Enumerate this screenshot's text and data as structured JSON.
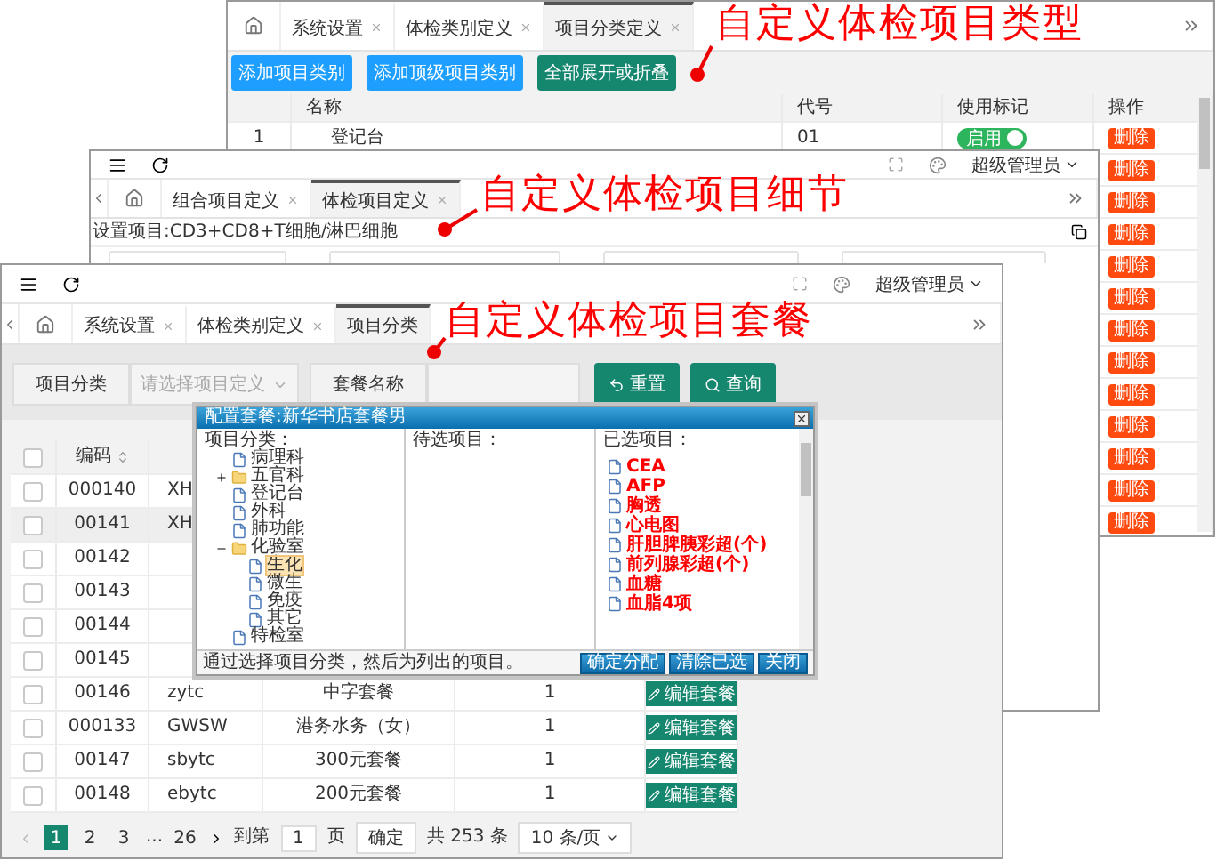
{
  "windows": [
    {
      "kind": "categories",
      "tabs": [
        {
          "label": "系统设置",
          "selected": false
        },
        {
          "label": "体检类别定义",
          "selected": false
        },
        {
          "label": "项目分类定义",
          "selected": true
        }
      ],
      "toolbar": [
        {
          "label": "添加项目类别",
          "color": "#1e9fff"
        },
        {
          "label": "添加顶级项目类别",
          "color": "#1e9fff"
        },
        {
          "label": "全部展开或折叠",
          "color": "#16876f"
        }
      ],
      "columns": [
        "名称",
        "代号",
        "使用标记",
        "操作"
      ],
      "rows": [
        {
          "index": "1",
          "name": "登记台",
          "code": "01",
          "flag": {
            "on": true,
            "label": "启用"
          },
          "action": "删除"
        },
        {
          "action": "删除"
        },
        {
          "action": "删除"
        },
        {
          "action": "删除"
        },
        {
          "action": "删除"
        },
        {
          "action": "删除"
        },
        {
          "action": "删除"
        },
        {
          "action": "删除"
        },
        {
          "action": "删除"
        },
        {
          "action": "删除"
        },
        {
          "action": "删除"
        },
        {
          "action": "删除"
        },
        {
          "action": "删除"
        }
      ]
    },
    {
      "kind": "details",
      "user": "超级管理员",
      "tabs": [
        {
          "label": "组合项目定义",
          "selected": false
        },
        {
          "label": "体检项目定义",
          "selected": true
        }
      ],
      "breadcrumb": "设置项目:CD3+CD8+T细胞/淋巴细胞"
    },
    {
      "kind": "packages",
      "user": "超级管理员",
      "tabs": [
        {
          "label": "系统设置",
          "selected": false,
          "closable": true
        },
        {
          "label": "体检类别定义",
          "selected": false,
          "closable": true
        },
        {
          "label": "项目分类",
          "selected": true,
          "closable": false
        }
      ],
      "filters": {
        "category_label": "项目分类",
        "category_placeholder": "请选择项目定义",
        "name_label": "套餐名称",
        "reset": "重置",
        "search": "查询"
      },
      "columns": [
        "编码"
      ],
      "all_checked": false,
      "rows": [
        {
          "code": "000140",
          "column_3": "XH",
          "checked": false
        },
        {
          "code": "00141",
          "column_3": "XH",
          "checked": false
        },
        {
          "code": "00142",
          "checked": false
        },
        {
          "code": "00143",
          "checked": false
        },
        {
          "code": "00144",
          "checked": false
        },
        {
          "code": "00145",
          "checked": false
        },
        {
          "code": "00146",
          "column_3": "zytc",
          "name": "中字套餐",
          "column_5": "1",
          "action": "编辑套餐",
          "checked": false
        },
        {
          "code": "000133",
          "column_3": "GWSW",
          "name": "港务水务（女）",
          "column_5": "1",
          "action": "编辑套餐",
          "checked": false
        },
        {
          "code": "00147",
          "column_3": "sbytc",
          "name": "300元套餐",
          "column_5": "1",
          "action": "编辑套餐",
          "checked": false
        },
        {
          "code": "00148",
          "column_3": "ebytc",
          "name": "200元套餐",
          "column_5": "1",
          "action": "编辑套餐",
          "checked": false
        }
      ],
      "pagination": {
        "pages": [
          {
            "label": "1",
            "selected": true
          },
          {
            "label": "2",
            "selected": false
          },
          {
            "label": "3",
            "selected": false
          }
        ],
        "ellipsis": "...",
        "last": "26",
        "goto_label": "到第",
        "goto_value": "1",
        "page_unit": "页",
        "confirm": "确定",
        "total": "共 253 条",
        "page_size": "10 条/页"
      }
    }
  ],
  "dialog": {
    "title": "配置套餐:新华书店套餐男",
    "category_heading": "项目分类：",
    "pending_heading": "待选项目：",
    "selected_heading": "已选项目：",
    "tree": [
      {
        "label": "病理科",
        "folder": false,
        "selected": false
      },
      {
        "label": "五官科",
        "folder": true,
        "expanded": false,
        "selected": false
      },
      {
        "label": "登记台",
        "folder": false,
        "selected": false
      },
      {
        "label": "外科",
        "folder": false,
        "selected": false
      },
      {
        "label": "肺功能",
        "folder": false,
        "selected": false
      },
      {
        "label": "化验室",
        "folder": true,
        "expanded": true,
        "selected": false,
        "children": [
          {
            "label": "生化",
            "folder": false,
            "selected": true
          },
          {
            "label": "微生",
            "folder": false,
            "selected": false
          },
          {
            "label": "免疫",
            "folder": false,
            "selected": false
          },
          {
            "label": "其它",
            "folder": false,
            "selected": false
          }
        ]
      },
      {
        "label": "特检室",
        "folder": false,
        "selected": false
      }
    ],
    "chosen": [
      "CEA",
      "AFP",
      "胸透",
      "心电图",
      "肝胆脾胰彩超(个)",
      "前列腺彩超(个)",
      "血糖",
      "血脂4项"
    ],
    "hint": "通过选择项目分类，然后为列出的项目。",
    "buttons": [
      "确定分配",
      "清除已选",
      "关闭"
    ]
  },
  "annotations": [
    "自定义体检项目类型",
    "自定义体检项目细节",
    "自定义体检项目套餐"
  ]
}
